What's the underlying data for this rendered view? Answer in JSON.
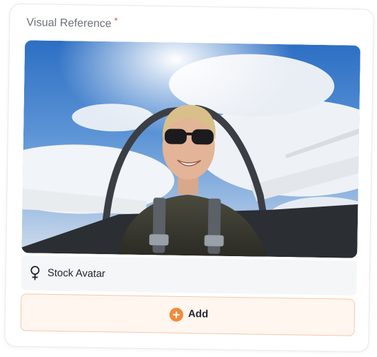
{
  "field": {
    "label": "Visual Reference",
    "required_mark": "*"
  },
  "image": {
    "description_icon": "photo"
  },
  "avatar": {
    "icon": "female-symbol-icon",
    "label": "Stock Avatar"
  },
  "add_button": {
    "icon": "plus-circle-icon",
    "label": "Add"
  },
  "colors": {
    "accent": "#f28a3c",
    "required": "#e5484d",
    "add_background": "#fff6f0",
    "add_border": "#f6c6a6"
  }
}
